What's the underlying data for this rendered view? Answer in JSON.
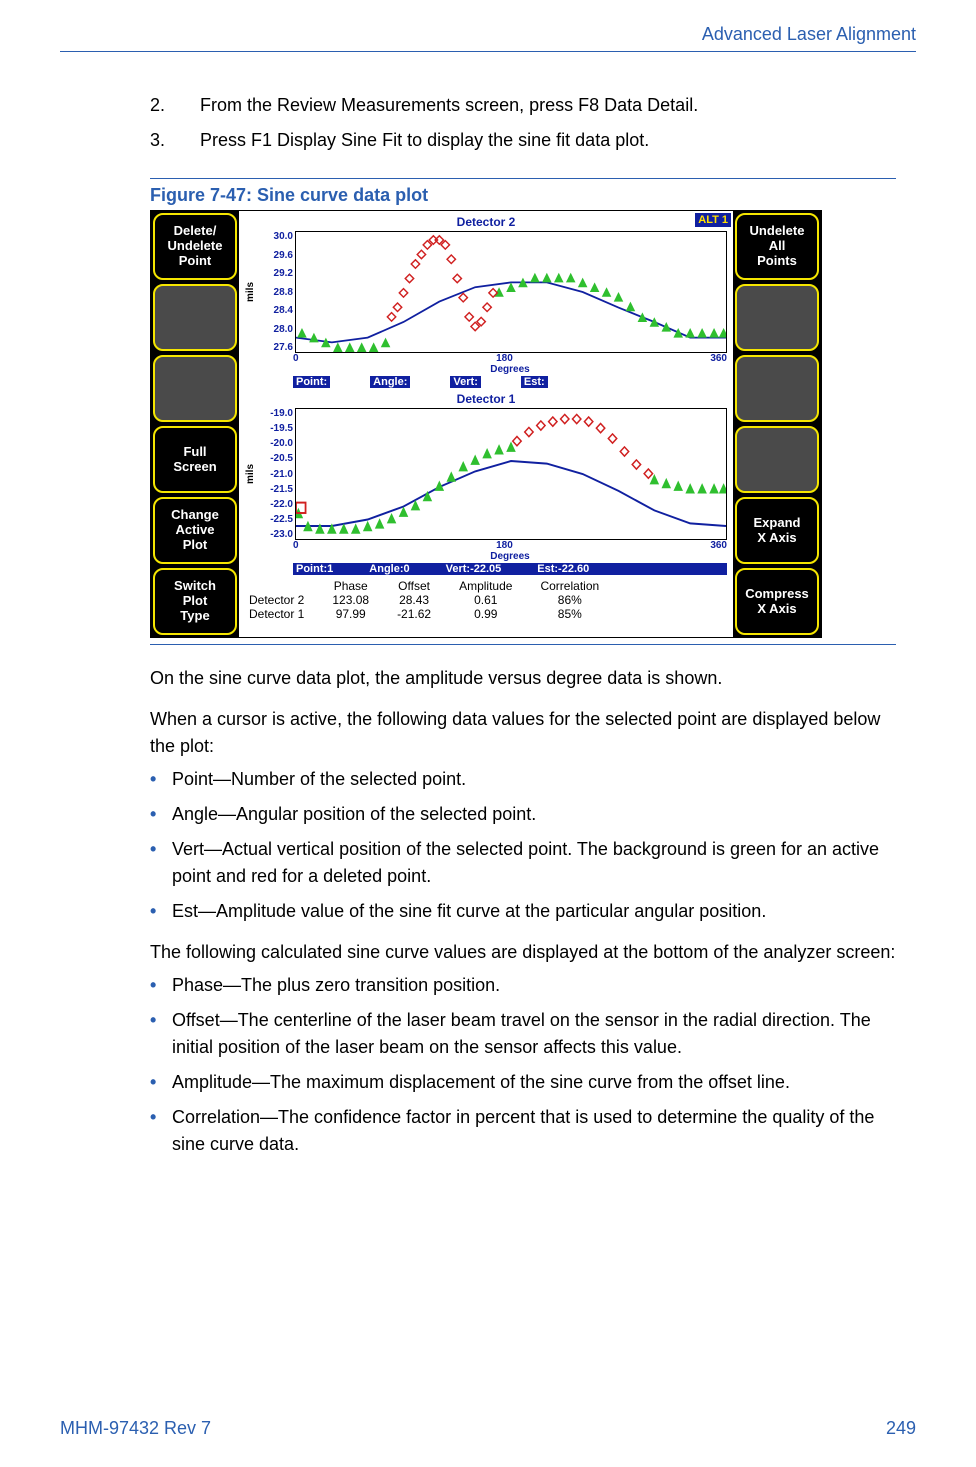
{
  "header": {
    "section": "Advanced Laser Alignment"
  },
  "steps": [
    {
      "n": "2.",
      "text_a": "From the Review Measurements screen, press ",
      "kbd": "F8 Data Detail",
      "text_b": "."
    },
    {
      "n": "3.",
      "text_a": "Press ",
      "kbd": "F1 Display Sine Fit",
      "text_b": " to display the sine fit data plot."
    }
  ],
  "figure": {
    "label": "Figure 7-47:   Sine curve data plot",
    "alt_badge": "ALT 1",
    "left_softkeys": [
      "Delete/\nUndelete\nPoint",
      "",
      "",
      "Full\nScreen",
      "Change\nActive\nPlot",
      "Switch\nPlot\nType"
    ],
    "right_softkeys": [
      "Undelete\nAll\nPoints",
      "",
      "",
      "",
      "Expand\nX Axis",
      "Compress\nX Axis"
    ],
    "chart2": {
      "title": "Detector 2",
      "ylabel": "mils",
      "yticks": [
        "30.0",
        "29.6",
        "29.2",
        "28.8",
        "28.4",
        "28.0",
        "27.6"
      ],
      "xticks": [
        "0",
        "180",
        "360"
      ],
      "xlabel": "Degrees",
      "status": {
        "point": "Point:",
        "angle": "Angle:",
        "vert": "Vert:",
        "est": "Est:"
      }
    },
    "chart1": {
      "title": "Detector 1",
      "ylabel": "mils",
      "yticks": [
        "-19.0",
        "-19.5",
        "-20.0",
        "-20.5",
        "-21.0",
        "-21.5",
        "-22.0",
        "-22.5",
        "-23.0"
      ],
      "xticks": [
        "0",
        "180",
        "360"
      ],
      "xlabel": "Degrees",
      "status": {
        "point": "Point:1",
        "angle": "Angle:0",
        "vert": "Vert:-22.05",
        "est": "Est:-22.60"
      }
    },
    "summary": {
      "headers": [
        "",
        "Phase",
        "Offset",
        "Amplitude",
        "Correlation"
      ],
      "rows": [
        [
          "Detector 2",
          "123.08",
          "28.43",
          "0.61",
          "86%"
        ],
        [
          "Detector 1",
          "97.99",
          "-21.62",
          "0.99",
          "85%"
        ]
      ]
    }
  },
  "chart_data": [
    {
      "type": "scatter-line",
      "title": "Detector 2",
      "xlabel": "Degrees",
      "ylabel": "mils",
      "xlim": [
        0,
        360
      ],
      "ylim": [
        27.6,
        30.0
      ],
      "series": [
        {
          "name": "sine-fit",
          "style": "line",
          "color": "#1020a0",
          "x": [
            0,
            30,
            60,
            90,
            120,
            150,
            180,
            210,
            240,
            270,
            300,
            330,
            360
          ],
          "y": [
            27.9,
            27.8,
            27.9,
            28.2,
            28.6,
            28.9,
            29.0,
            29.0,
            28.8,
            28.5,
            28.2,
            27.9,
            27.9
          ]
        },
        {
          "name": "active-points",
          "style": "triangle",
          "color": "#2fbf2f",
          "x": [
            5,
            15,
            25,
            35,
            45,
            55,
            65,
            75,
            170,
            180,
            190,
            200,
            210,
            220,
            230,
            240,
            250,
            260,
            270,
            280,
            290,
            300,
            310,
            320,
            330,
            340,
            350,
            360
          ],
          "y": [
            28.1,
            28.0,
            27.9,
            27.8,
            27.8,
            27.8,
            27.8,
            27.9,
            28.9,
            29.0,
            29.1,
            29.2,
            29.2,
            29.2,
            29.2,
            29.1,
            29.0,
            28.9,
            28.8,
            28.6,
            28.4,
            28.3,
            28.2,
            28.1,
            28.1,
            28.1,
            28.1,
            28.1
          ]
        },
        {
          "name": "deleted-points",
          "style": "diamond",
          "color": "#d02020",
          "x": [
            80,
            85,
            90,
            95,
            100,
            105,
            110,
            115,
            120,
            125,
            130,
            135,
            140,
            145,
            150,
            155,
            160,
            165
          ],
          "y": [
            28.3,
            28.5,
            28.8,
            29.1,
            29.4,
            29.6,
            29.8,
            29.9,
            29.9,
            29.8,
            29.5,
            29.1,
            28.7,
            28.3,
            28.1,
            28.2,
            28.5,
            28.8
          ]
        }
      ]
    },
    {
      "type": "scatter-line",
      "title": "Detector 1",
      "xlabel": "Degrees",
      "ylabel": "mils",
      "xlim": [
        0,
        360
      ],
      "ylim": [
        -23.0,
        -19.0
      ],
      "series": [
        {
          "name": "sine-fit",
          "style": "line",
          "color": "#1020a0",
          "x": [
            0,
            30,
            60,
            90,
            120,
            150,
            180,
            210,
            240,
            270,
            300,
            330,
            360
          ],
          "y": [
            -22.6,
            -22.6,
            -22.4,
            -22.0,
            -21.4,
            -20.9,
            -20.6,
            -20.7,
            -21.0,
            -21.5,
            -22.1,
            -22.5,
            -22.6
          ]
        },
        {
          "name": "active-points",
          "style": "triangle",
          "color": "#2fbf2f",
          "x": [
            0,
            10,
            20,
            30,
            40,
            50,
            60,
            70,
            80,
            90,
            100,
            110,
            120,
            130,
            140,
            150,
            160,
            170,
            180,
            300,
            310,
            320,
            330,
            340,
            350,
            360
          ],
          "y": [
            -22.1,
            -22.5,
            -22.6,
            -22.6,
            -22.6,
            -22.6,
            -22.5,
            -22.4,
            -22.2,
            -22.0,
            -21.8,
            -21.5,
            -21.2,
            -20.9,
            -20.6,
            -20.4,
            -20.2,
            -20.1,
            -20.0,
            -21.0,
            -21.1,
            -21.2,
            -21.3,
            -21.3,
            -21.3,
            -21.3
          ]
        },
        {
          "name": "deleted-points",
          "style": "diamond",
          "color": "#d02020",
          "x": [
            185,
            195,
            205,
            215,
            225,
            235,
            245,
            255,
            265,
            275,
            285,
            295
          ],
          "y": [
            -19.9,
            -19.6,
            -19.4,
            -19.3,
            -19.2,
            -19.2,
            -19.3,
            -19.5,
            -19.8,
            -20.2,
            -20.6,
            -20.9
          ]
        }
      ],
      "cursor": {
        "point": 1,
        "angle": 0,
        "vert": -22.05,
        "est": -22.6
      }
    }
  ],
  "body": {
    "p1": "On the sine curve data plot, the amplitude versus degree data is shown.",
    "p2": "When a cursor is active, the following data values for the selected point are displayed below the plot:",
    "list1": [
      "Point—Number of the selected point.",
      "Angle—Angular position of the selected point.",
      "Vert—Actual vertical position of the selected point. The background is green for an active point and red for a deleted point.",
      "Est—Amplitude value of the sine fit curve at the particular angular position."
    ],
    "p3": "The following calculated sine curve values are displayed at the bottom of the analyzer screen:",
    "list2": [
      "Phase—The plus zero transition position.",
      "Offset—The centerline of the laser beam travel on the sensor in the radial direction. The initial position of the laser beam on the sensor affects this value.",
      "Amplitude—The maximum displacement of the sine curve from the offset line.",
      "Correlation—The confidence factor in percent that is used to determine the quality of the sine curve data."
    ]
  },
  "footer": {
    "left": "MHM-97432 Rev 7",
    "right": "249"
  }
}
